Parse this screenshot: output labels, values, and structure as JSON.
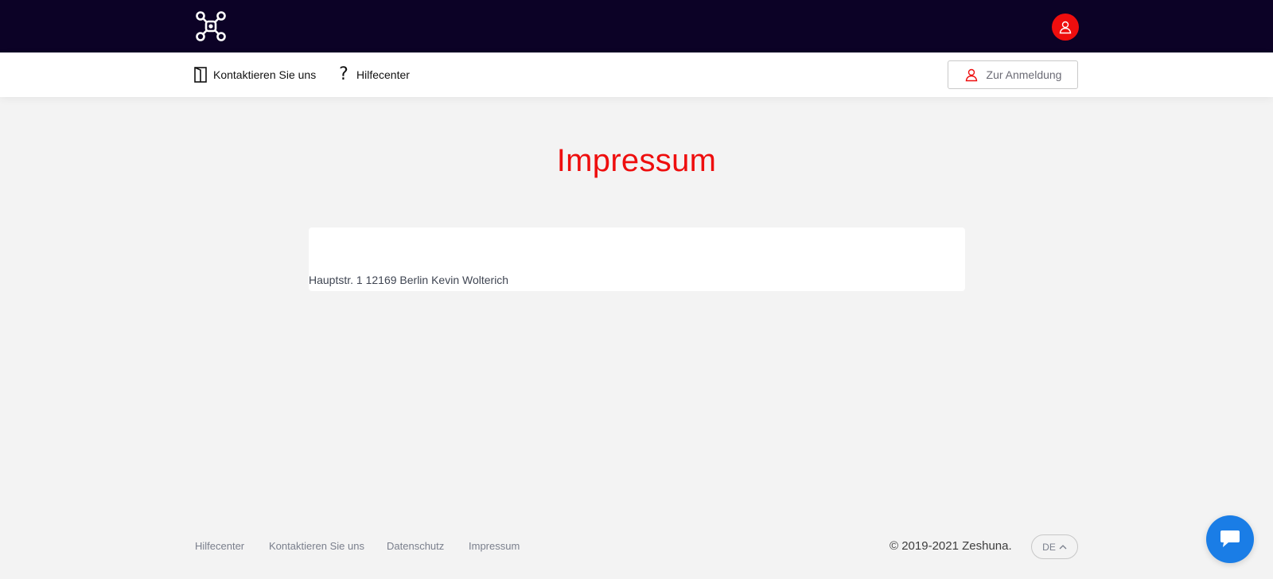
{
  "header": {
    "logo_icon": "drone-network-logo",
    "user_icon": "user-icon",
    "colors": {
      "background": "#0c0226",
      "avatar": "#ee0e0e"
    }
  },
  "subnav": {
    "contact_label": "Kontaktieren Sie uns",
    "contact_icon": "door-icon",
    "help_label": "Hilfecenter",
    "help_icon": "question-icon",
    "login_label": "Zur Anmeldung",
    "login_icon": "user-icon"
  },
  "main": {
    "title": "Impressum",
    "address": "Hauptstr. 1 12169 Berlin Kevin Wolterich",
    "title_color": "#ee0e0e"
  },
  "footer": {
    "links": [
      "Hilfecenter",
      "Kontaktieren Sie uns",
      "Datenschutz",
      "Impressum"
    ],
    "copyright": "© 2019-2021 Zeshuna.",
    "language": "DE"
  },
  "chat": {
    "icon": "chat-icon",
    "color": "#1a7de6"
  }
}
